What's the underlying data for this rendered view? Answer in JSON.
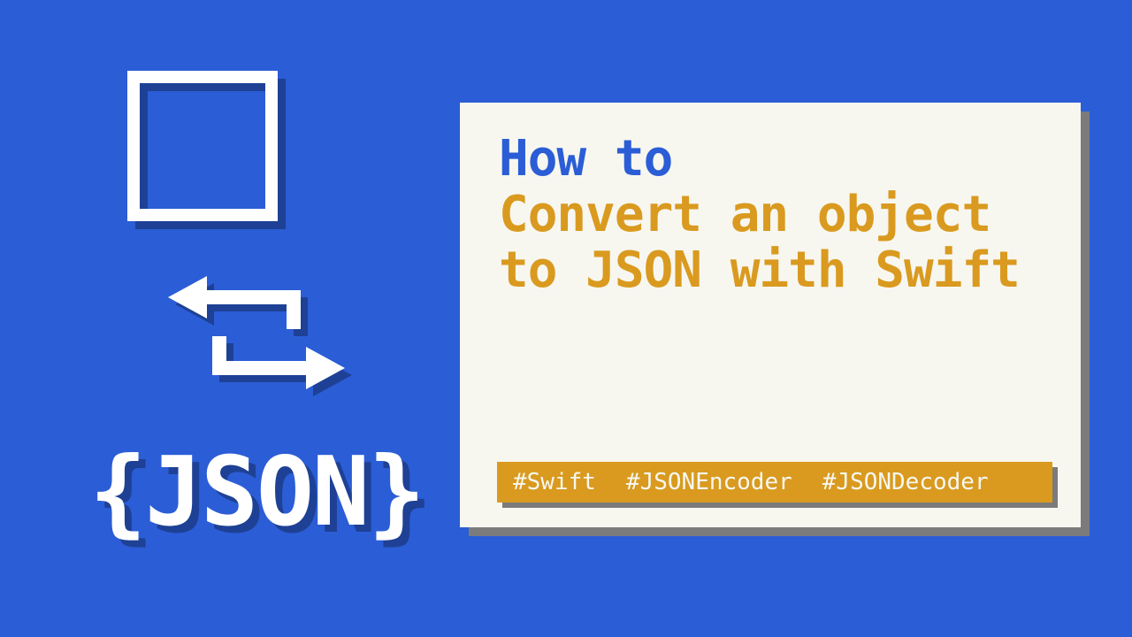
{
  "colors": {
    "background": "#2b5dd6",
    "card_bg": "#f7f7f0",
    "accent_blue": "#2b5dd6",
    "accent_gold": "#d99a1f",
    "shadow_gray": "#7b7b7b",
    "icon_white": "#ffffff"
  },
  "left": {
    "icons": {
      "square": "square-icon",
      "swap": "convert-arrows-icon"
    },
    "json_label": "{JSON}"
  },
  "card": {
    "title_line1": "How to",
    "title_line2": "Convert an object to JSON with Swift",
    "tags": [
      "#Swift",
      "#JSONEncoder",
      "#JSONDecoder"
    ]
  }
}
